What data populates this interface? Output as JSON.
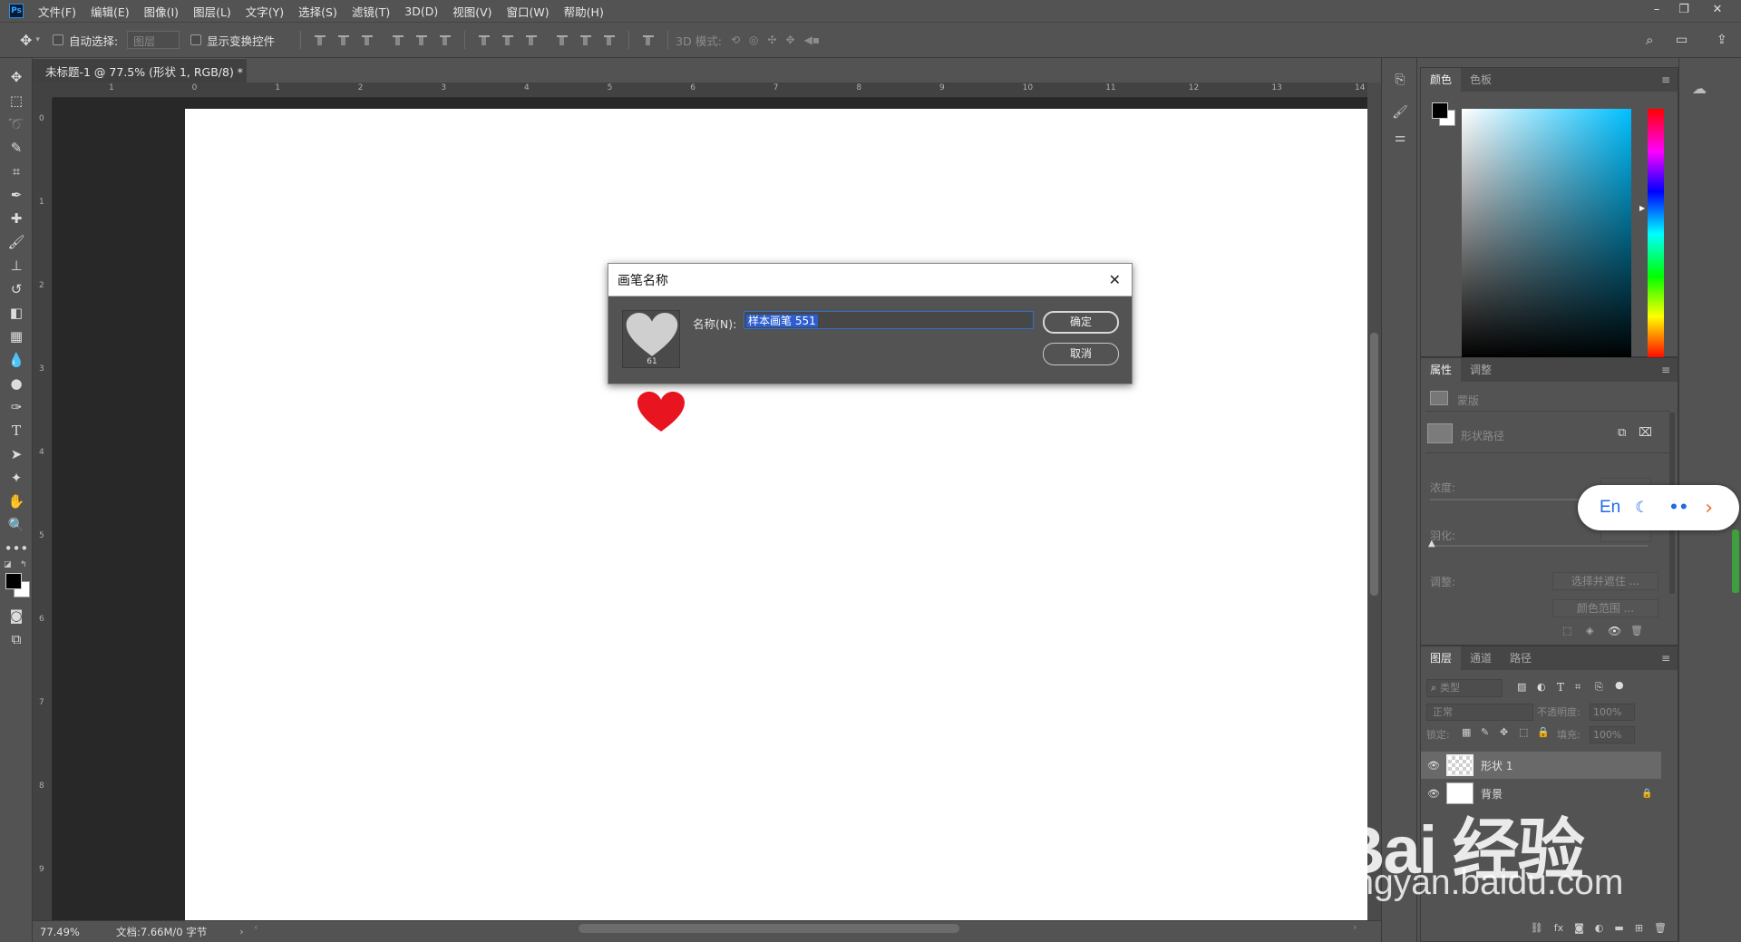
{
  "app": {
    "logo": "Ps",
    "menus": [
      "文件(F)",
      "编辑(E)",
      "图像(I)",
      "图层(L)",
      "文字(Y)",
      "选择(S)",
      "滤镜(T)",
      "3D(D)",
      "视图(V)",
      "窗口(W)",
      "帮助(H)"
    ]
  },
  "options": {
    "auto_select_label": "自动选择:",
    "auto_select_value": "图层",
    "show_transform_label": "显示变换控件",
    "mode_3d_label": "3D 模式:"
  },
  "document": {
    "tab_title": "未标题-1 @ 77.5% (形状 1, RGB/8) *",
    "close_glyph": "×",
    "zoom": "77.49%",
    "doc_size": "文档:7.66M/0 字节",
    "ruler_h": [
      "1",
      "0",
      "1",
      "2",
      "3",
      "4",
      "5",
      "6",
      "7",
      "8",
      "9",
      "10",
      "11",
      "12",
      "13",
      "14"
    ],
    "ruler_v": [
      "0",
      "1",
      "2",
      "3",
      "4",
      "5",
      "6",
      "7",
      "8",
      "9"
    ]
  },
  "dialog": {
    "title": "画笔名称",
    "close_glyph": "✕",
    "name_label": "名称(N):",
    "name_value": "样本画笔 551",
    "brush_size": "61",
    "ok_label": "确定",
    "cancel_label": "取消"
  },
  "color_panel": {
    "tabs": [
      "颜色",
      "色板"
    ],
    "foreground": "#000000",
    "background": "#ffffff",
    "hue_color": "#00bfff"
  },
  "properties_panel": {
    "tabs": [
      "属性",
      "调整"
    ],
    "mask_label": "蒙版",
    "shape_path_label": "形状路径",
    "density_label": "浓度:",
    "feather_label": "羽化:",
    "adjust_label": "调整:",
    "select_mask_btn": "选择并遮住 ...",
    "color_range_btn": "颜色范围 ..."
  },
  "layers_panel": {
    "tabs": [
      "图层",
      "通道",
      "路径"
    ],
    "filter_label": "类型",
    "blend_mode": "正常",
    "opacity_label": "不透明度:",
    "opacity_value": "100%",
    "lock_label": "锁定:",
    "fill_label": "填充:",
    "fill_value": "100%",
    "layers": [
      {
        "name": "形状 1"
      },
      {
        "name": "背景"
      }
    ]
  },
  "ime": {
    "lang": "En"
  },
  "watermark": {
    "main": "Bai 经验",
    "sub": "jingyan.baidu.com"
  },
  "colors": {
    "heart": "#e8141f",
    "accent": "#2c5dd1"
  }
}
